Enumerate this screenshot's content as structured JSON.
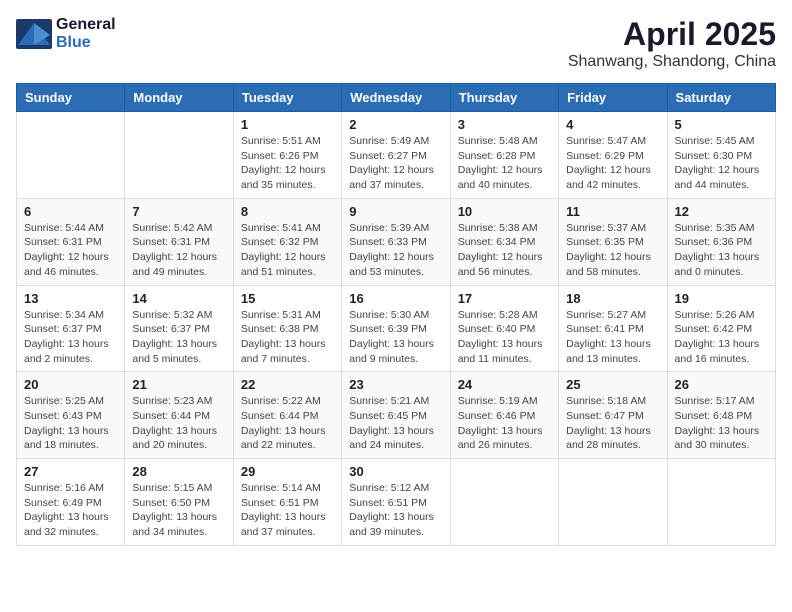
{
  "logo": {
    "general": "General",
    "blue": "Blue"
  },
  "title": "April 2025",
  "location": "Shanwang, Shandong, China",
  "weekdays": [
    "Sunday",
    "Monday",
    "Tuesday",
    "Wednesday",
    "Thursday",
    "Friday",
    "Saturday"
  ],
  "weeks": [
    [
      {
        "day": "",
        "info": ""
      },
      {
        "day": "",
        "info": ""
      },
      {
        "day": "1",
        "info": "Sunrise: 5:51 AM\nSunset: 6:26 PM\nDaylight: 12 hours and 35 minutes."
      },
      {
        "day": "2",
        "info": "Sunrise: 5:49 AM\nSunset: 6:27 PM\nDaylight: 12 hours and 37 minutes."
      },
      {
        "day": "3",
        "info": "Sunrise: 5:48 AM\nSunset: 6:28 PM\nDaylight: 12 hours and 40 minutes."
      },
      {
        "day": "4",
        "info": "Sunrise: 5:47 AM\nSunset: 6:29 PM\nDaylight: 12 hours and 42 minutes."
      },
      {
        "day": "5",
        "info": "Sunrise: 5:45 AM\nSunset: 6:30 PM\nDaylight: 12 hours and 44 minutes."
      }
    ],
    [
      {
        "day": "6",
        "info": "Sunrise: 5:44 AM\nSunset: 6:31 PM\nDaylight: 12 hours and 46 minutes."
      },
      {
        "day": "7",
        "info": "Sunrise: 5:42 AM\nSunset: 6:31 PM\nDaylight: 12 hours and 49 minutes."
      },
      {
        "day": "8",
        "info": "Sunrise: 5:41 AM\nSunset: 6:32 PM\nDaylight: 12 hours and 51 minutes."
      },
      {
        "day": "9",
        "info": "Sunrise: 5:39 AM\nSunset: 6:33 PM\nDaylight: 12 hours and 53 minutes."
      },
      {
        "day": "10",
        "info": "Sunrise: 5:38 AM\nSunset: 6:34 PM\nDaylight: 12 hours and 56 minutes."
      },
      {
        "day": "11",
        "info": "Sunrise: 5:37 AM\nSunset: 6:35 PM\nDaylight: 12 hours and 58 minutes."
      },
      {
        "day": "12",
        "info": "Sunrise: 5:35 AM\nSunset: 6:36 PM\nDaylight: 13 hours and 0 minutes."
      }
    ],
    [
      {
        "day": "13",
        "info": "Sunrise: 5:34 AM\nSunset: 6:37 PM\nDaylight: 13 hours and 2 minutes."
      },
      {
        "day": "14",
        "info": "Sunrise: 5:32 AM\nSunset: 6:37 PM\nDaylight: 13 hours and 5 minutes."
      },
      {
        "day": "15",
        "info": "Sunrise: 5:31 AM\nSunset: 6:38 PM\nDaylight: 13 hours and 7 minutes."
      },
      {
        "day": "16",
        "info": "Sunrise: 5:30 AM\nSunset: 6:39 PM\nDaylight: 13 hours and 9 minutes."
      },
      {
        "day": "17",
        "info": "Sunrise: 5:28 AM\nSunset: 6:40 PM\nDaylight: 13 hours and 11 minutes."
      },
      {
        "day": "18",
        "info": "Sunrise: 5:27 AM\nSunset: 6:41 PM\nDaylight: 13 hours and 13 minutes."
      },
      {
        "day": "19",
        "info": "Sunrise: 5:26 AM\nSunset: 6:42 PM\nDaylight: 13 hours and 16 minutes."
      }
    ],
    [
      {
        "day": "20",
        "info": "Sunrise: 5:25 AM\nSunset: 6:43 PM\nDaylight: 13 hours and 18 minutes."
      },
      {
        "day": "21",
        "info": "Sunrise: 5:23 AM\nSunset: 6:44 PM\nDaylight: 13 hours and 20 minutes."
      },
      {
        "day": "22",
        "info": "Sunrise: 5:22 AM\nSunset: 6:44 PM\nDaylight: 13 hours and 22 minutes."
      },
      {
        "day": "23",
        "info": "Sunrise: 5:21 AM\nSunset: 6:45 PM\nDaylight: 13 hours and 24 minutes."
      },
      {
        "day": "24",
        "info": "Sunrise: 5:19 AM\nSunset: 6:46 PM\nDaylight: 13 hours and 26 minutes."
      },
      {
        "day": "25",
        "info": "Sunrise: 5:18 AM\nSunset: 6:47 PM\nDaylight: 13 hours and 28 minutes."
      },
      {
        "day": "26",
        "info": "Sunrise: 5:17 AM\nSunset: 6:48 PM\nDaylight: 13 hours and 30 minutes."
      }
    ],
    [
      {
        "day": "27",
        "info": "Sunrise: 5:16 AM\nSunset: 6:49 PM\nDaylight: 13 hours and 32 minutes."
      },
      {
        "day": "28",
        "info": "Sunrise: 5:15 AM\nSunset: 6:50 PM\nDaylight: 13 hours and 34 minutes."
      },
      {
        "day": "29",
        "info": "Sunrise: 5:14 AM\nSunset: 6:51 PM\nDaylight: 13 hours and 37 minutes."
      },
      {
        "day": "30",
        "info": "Sunrise: 5:12 AM\nSunset: 6:51 PM\nDaylight: 13 hours and 39 minutes."
      },
      {
        "day": "",
        "info": ""
      },
      {
        "day": "",
        "info": ""
      },
      {
        "day": "",
        "info": ""
      }
    ]
  ]
}
